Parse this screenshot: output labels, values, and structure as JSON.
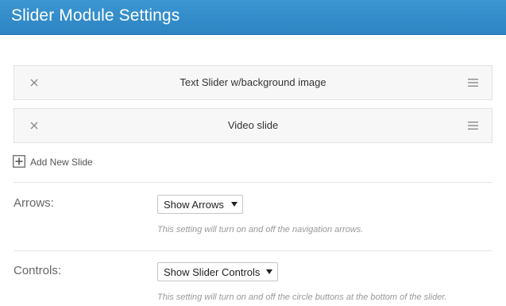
{
  "header": {
    "title": "Slider Module Settings",
    "background_color": "#2f88c6"
  },
  "slides": [
    {
      "title": "Text Slider w/background image",
      "remove_icon": "close-icon",
      "drag_icon": "hamburger-drag-icon"
    },
    {
      "title": "Video slide",
      "remove_icon": "close-icon",
      "drag_icon": "hamburger-drag-icon"
    }
  ],
  "add_slide": {
    "label": "Add New Slide",
    "icon": "plus-box-icon"
  },
  "settings": {
    "arrows": {
      "label": "Arrows:",
      "selected": "Show Arrows",
      "help": "This setting will turn on and off the navigation arrows."
    },
    "controls": {
      "label": "Controls:",
      "selected": "Show Slider Controls",
      "help": "This setting will turn on and off the circle buttons at the bottom of the slider."
    }
  }
}
